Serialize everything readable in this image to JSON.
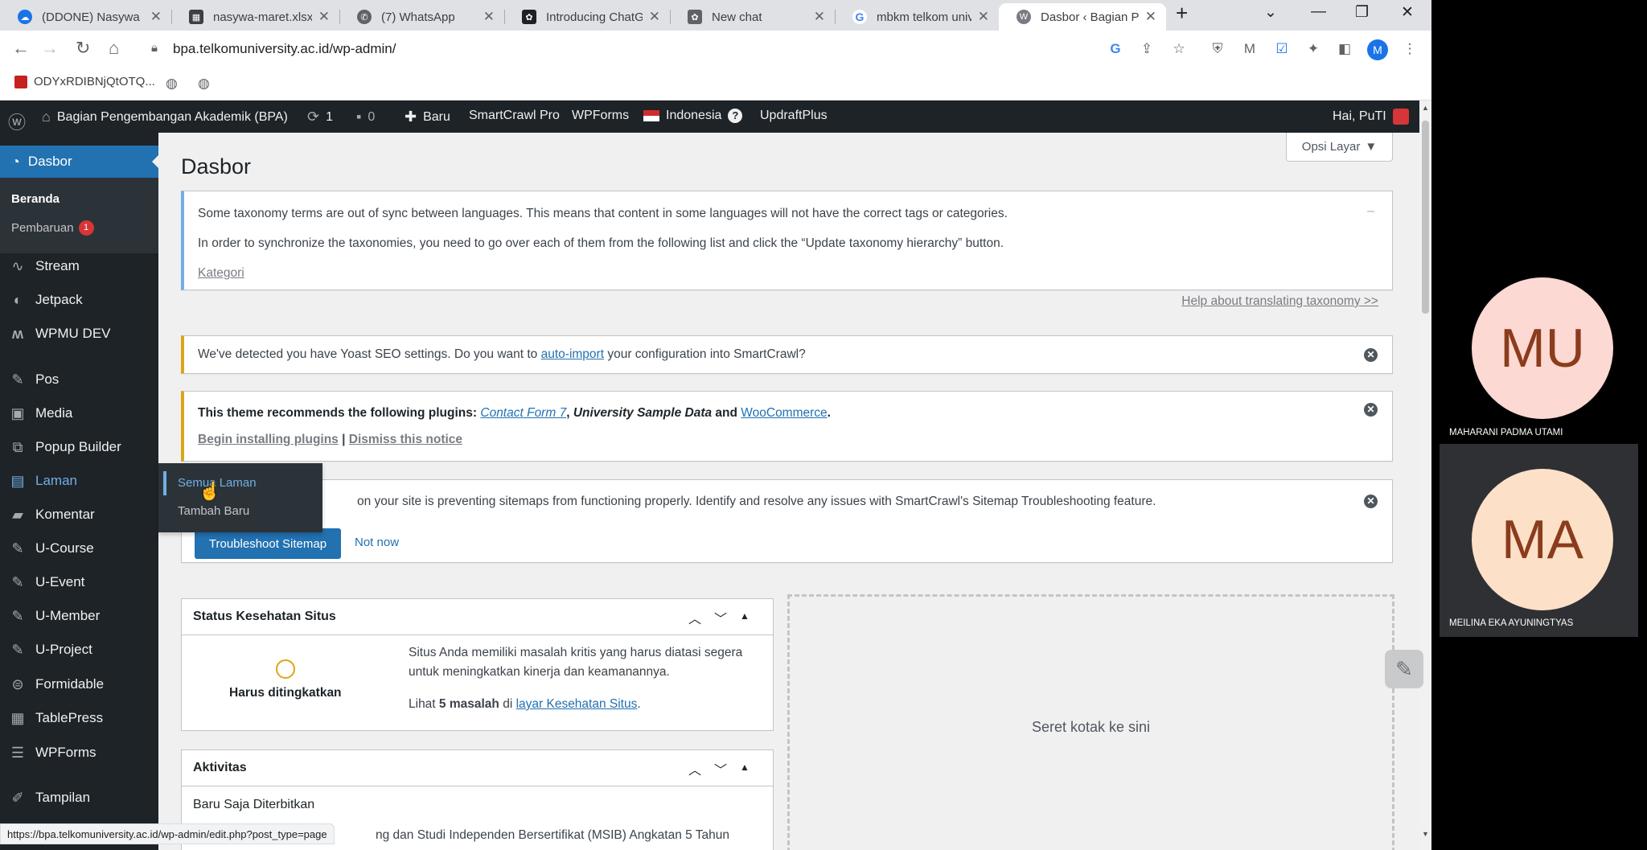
{
  "browser": {
    "tabs": [
      {
        "label": "(DDONE) Nasywa",
        "icon": "cloud-icon",
        "color": "#1a73e8"
      },
      {
        "label": "nasywa-maret.xlsx",
        "icon": "spreadsheet-icon",
        "color": "#5f6368"
      },
      {
        "label": "(7) WhatsApp",
        "icon": "whatsapp-icon",
        "color": "#5f6368"
      },
      {
        "label": "Introducing ChatGPT",
        "icon": "openai-icon",
        "color": "#202124"
      },
      {
        "label": "New chat",
        "icon": "chat-icon",
        "color": "#5f6368"
      },
      {
        "label": "mbkm telkom university",
        "icon": "google-icon",
        "color": "#5f6368"
      },
      {
        "label": "Dasbor ‹ Bagian Pengembangan",
        "icon": "wp-icon",
        "color": "#5f6368"
      }
    ],
    "new_tab_label": "+",
    "url": "bpa.telkomuniversity.ac.id/wp-admin/",
    "profile_initial": "M",
    "bookmarks": {
      "first": "ODYxRDIBNjQtOTQ..."
    },
    "status_url": "https://bpa.telkomuniversity.ac.id/wp-admin/edit.php?post_type=page"
  },
  "adminbar": {
    "site_name": "Bagian Pengembangan Akademik (BPA)",
    "updates_count": "1",
    "comments_count": "0",
    "new_label": "Baru",
    "smartcrawl": "SmartCrawl Pro",
    "wpforms": "WPForms",
    "language": "Indonesia",
    "updraft": "UpdraftPlus",
    "greeting": "Hai, PuTI"
  },
  "sidebar": {
    "dashboard": "Dasbor",
    "sub_home": "Beranda",
    "sub_updates": "Pembaruan",
    "updates_badge": "1",
    "items": [
      {
        "label": "Stream",
        "icon": "pulse-icon"
      },
      {
        "label": "Jetpack",
        "icon": "jetpack-icon"
      },
      {
        "label": "WPMU DEV",
        "icon": "wpmu-icon"
      },
      {
        "label": "Pos",
        "icon": "pin-icon"
      },
      {
        "label": "Media",
        "icon": "media-icon"
      },
      {
        "label": "Popup Builder",
        "icon": "popup-icon"
      },
      {
        "label": "Laman",
        "icon": "page-icon"
      },
      {
        "label": "Komentar",
        "icon": "comment-icon"
      },
      {
        "label": "U-Course",
        "icon": "pin-icon"
      },
      {
        "label": "U-Event",
        "icon": "pin-icon"
      },
      {
        "label": "U-Member",
        "icon": "pin-icon"
      },
      {
        "label": "U-Project",
        "icon": "pin-icon"
      },
      {
        "label": "Formidable",
        "icon": "formidable-icon"
      },
      {
        "label": "TablePress",
        "icon": "table-icon"
      },
      {
        "label": "WPForms",
        "icon": "forms-icon"
      },
      {
        "label": "Tampilan",
        "icon": "brush-icon"
      }
    ],
    "flyout": {
      "all_pages": "Semua Laman",
      "add_new": "Tambah Baru"
    }
  },
  "page": {
    "title": "Dasbor",
    "screen_options": "Opsi Layar",
    "notice_taxonomy": {
      "line1": "Some taxonomy terms are out of sync between languages. This means that content in some languages will not have the correct tags or categories.",
      "line2": "In order to synchronize the taxonomies, you need to go over each of them from the following list and click the “Update taxonomy hierarchy” button.",
      "link": "Kategori",
      "help": "Help about translating taxonomy >>"
    },
    "notice_yoast": {
      "before": "We've detected you have Yoast SEO settings. Do you want to ",
      "link": "auto-import",
      "after": " your configuration into SmartCrawl?"
    },
    "notice_theme": {
      "prefix": "This theme recommends the following plugins: ",
      "plugin1": "Contact Form 7",
      "plugin2": "University Sample Data",
      "and": " and ",
      "plugin3": "WooCommerce",
      "install": "Begin installing plugins",
      "sep": " | ",
      "dismiss": "Dismiss this notice"
    },
    "notice_sitemap": {
      "text": "on your site is preventing sitemaps from functioning properly. Identify and resolve any issues with SmartCrawl's Sitemap Troubleshooting feature.",
      "button": "Troubleshoot Sitemap",
      "not_now": "Not now"
    },
    "health": {
      "title": "Status Kesehatan Situs",
      "status": "Harus ditingkatkan",
      "desc1": "Situs Anda memiliki masalah kritis yang harus diatasi segera",
      "desc2": "untuk meningkatkan kinerja dan keamanannya.",
      "link_prefix": "Lihat ",
      "issues": "5 masalah",
      "link_mid": " di ",
      "link": "layar Kesehatan Situs",
      "link_suffix": "."
    },
    "activity": {
      "title": "Aktivitas",
      "subtitle": "Baru Saja Diterbitkan",
      "item": "ng dan Studi Independen Bersertifikat (MSIB) Angkatan 5 Tahun"
    },
    "dropzone": "Seret kotak ke sini"
  },
  "meeting": {
    "participants": [
      {
        "initials": "MU",
        "name": "MAHARANI PADMA UTAMI",
        "color": "#fcd9d3"
      },
      {
        "initials": "MA",
        "name": "MEILINA EKA AYUNINGTYAS",
        "color": "#fde0c8"
      }
    ]
  },
  "colors": {
    "wp_dark": "#1d2327",
    "wp_blue": "#2271b1",
    "warn": "#dba617"
  }
}
